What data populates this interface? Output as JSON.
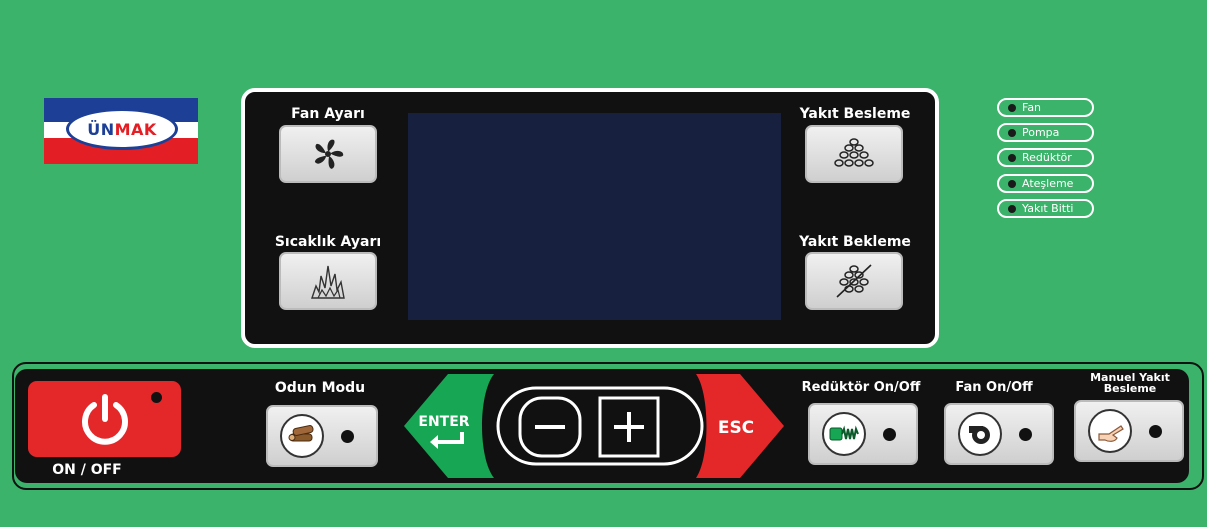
{
  "brand": {
    "part1": "ÜN",
    "part2": "MAK"
  },
  "display": {
    "fan_setting_label": "Fan Ayarı",
    "temperature_setting_label": "Sıcaklık Ayarı",
    "fuel_feed_label": "Yakıt Besleme",
    "fuel_wait_label": "Yakıt Bekleme"
  },
  "indicators": [
    {
      "label": "Fan"
    },
    {
      "label": "Pompa"
    },
    {
      "label": "Redüktör"
    },
    {
      "label": "Ateşleme"
    },
    {
      "label": "Yakıt Bitti"
    }
  ],
  "controls": {
    "power_label": "ON / OFF",
    "wood_mode_label": "Odun Modu",
    "enter_label": "ENTER",
    "esc_label": "ESC",
    "reducer_label": "Redüktör On/Off",
    "fan_label": "Fan On/Off",
    "manual_feed_label_line1": "Manuel Yakıt",
    "manual_feed_label_line2": "Besleme"
  },
  "colors": {
    "background": "#3bb36b",
    "panel": "#111111",
    "screen": "#17213f",
    "power": "#e4282a",
    "enter": "#17a653",
    "esc": "#e4282a",
    "logo_blue": "#1d3f96",
    "logo_red": "#e31e24"
  }
}
